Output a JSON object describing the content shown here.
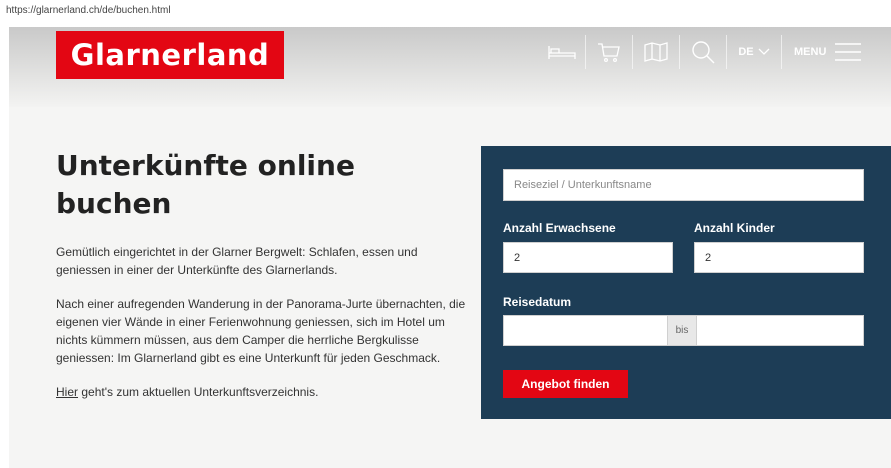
{
  "browser": {
    "url": "https://glarnerland.ch/de/buchen.html"
  },
  "header": {
    "logo": "Glarnerland",
    "language": "DE",
    "menu_label": "MENU",
    "icons": [
      "bed-icon",
      "cart-icon",
      "map-icon",
      "search-icon"
    ]
  },
  "main": {
    "title_line1": "Unterkünfte online",
    "title_line2": "buchen",
    "paragraph1": "Gemütlich eingerichtet in der Glarner Bergwelt: Schlafen, essen und geniessen in einer der Unterkünfte des Glarnerlands.",
    "paragraph2": "Nach einer aufregenden Wanderung in der Panorama-Jurte übernachten, die eigenen vier Wände in einer Ferienwohnung geniessen, sich im Hotel um nichts kümmern müssen, aus dem Camper die herrliche Bergkulisse geniessen: Im Glarnerland gibt es eine Unterkunft für jeden Geschmack.",
    "link_text": "Hier",
    "link_suffix": " geht's zum aktuellen Unterkunftsverzeichnis."
  },
  "search": {
    "destination_placeholder": "Reiseziel / Unterkunftsname",
    "adults_label": "Anzahl Erwachsene",
    "adults_value": "2",
    "children_label": "Anzahl Kinder",
    "children_value": "2",
    "date_label": "Reisedatum",
    "date_separator": "bis",
    "submit_label": "Angebot finden"
  },
  "colors": {
    "brand_red": "#e30613",
    "panel_navy": "#1d3d56"
  }
}
